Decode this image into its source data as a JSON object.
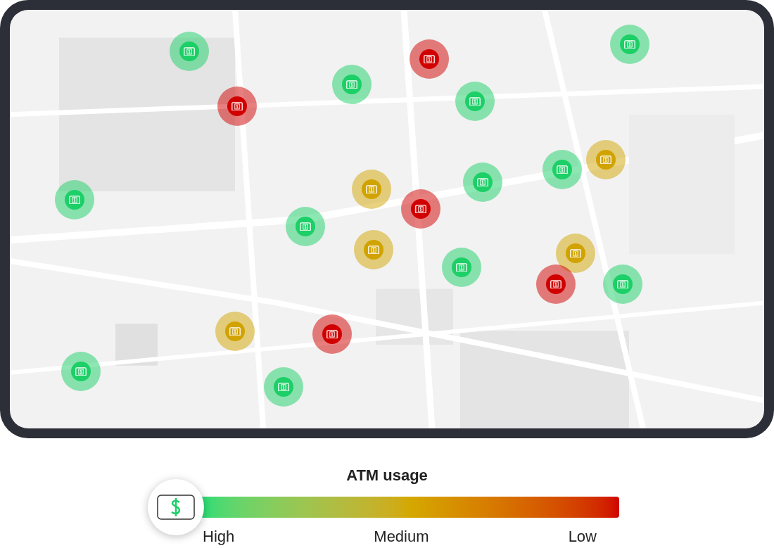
{
  "map": {
    "pins": [
      {
        "color": "#1ccf67"
      },
      {
        "color": "#1ccf67"
      },
      {
        "color": "#d10000"
      },
      {
        "color": "#1ccf67"
      },
      {
        "color": "#1ccf67"
      },
      {
        "color": "#d10000"
      },
      {
        "color": "#d1a300"
      },
      {
        "color": "#1ccf67"
      },
      {
        "color": "#d1a300"
      },
      {
        "color": "#1ccf67"
      },
      {
        "color": "#1ccf67"
      },
      {
        "color": "#d10000"
      },
      {
        "color": "#1ccf67"
      },
      {
        "color": "#d1a300"
      },
      {
        "color": "#1ccf67"
      },
      {
        "color": "#d1a300"
      },
      {
        "color": "#d10000"
      },
      {
        "color": "#1ccf67"
      },
      {
        "color": "#d1a300"
      },
      {
        "color": "#d10000"
      },
      {
        "color": "#1ccf67"
      },
      {
        "color": "#1ccf67"
      }
    ]
  },
  "legend": {
    "title": "ATM usage",
    "labels": [
      "High",
      "Medium",
      "Low"
    ]
  }
}
